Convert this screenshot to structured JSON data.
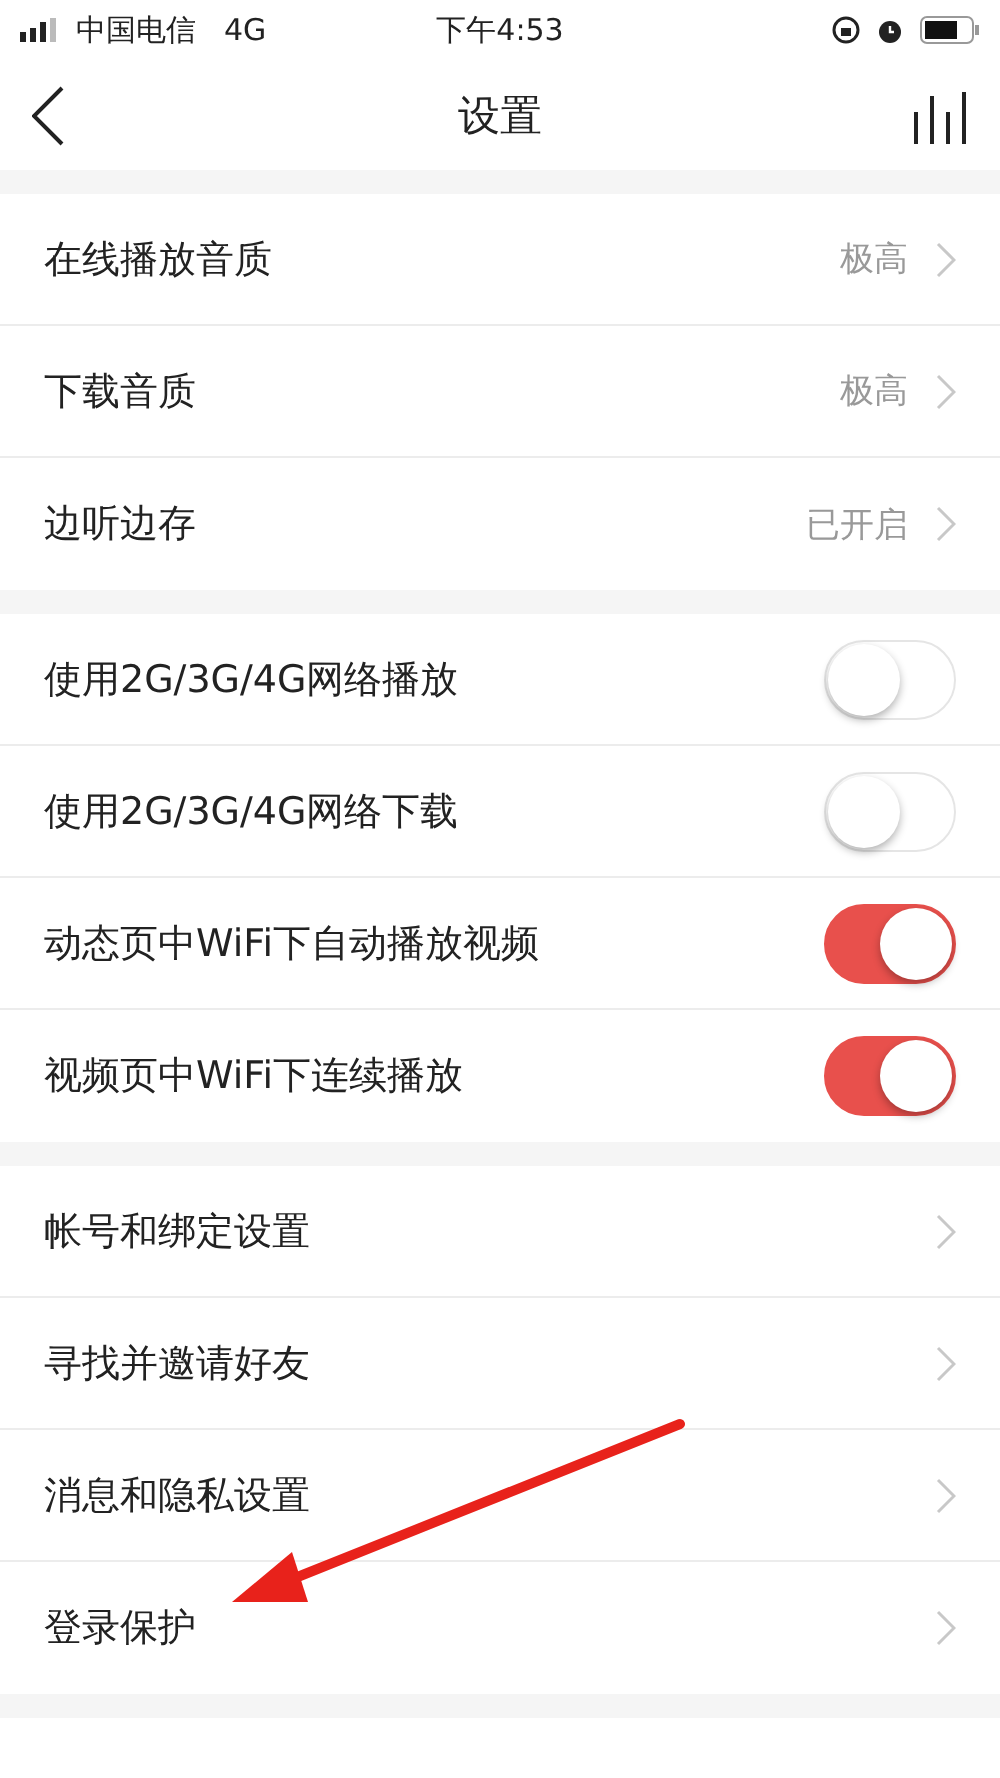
{
  "status_bar": {
    "carrier": "中国电信",
    "network": "4G",
    "time": "下午4:53"
  },
  "nav": {
    "title": "设置"
  },
  "groups": [
    {
      "items": [
        {
          "kind": "link",
          "label": "在线播放音质",
          "value": "极高"
        },
        {
          "kind": "link",
          "label": "下载音质",
          "value": "极高"
        },
        {
          "kind": "link",
          "label": "边听边存",
          "value": "已开启"
        }
      ]
    },
    {
      "items": [
        {
          "kind": "toggle",
          "label": "使用2G/3G/4G网络播放",
          "on": false
        },
        {
          "kind": "toggle",
          "label": "使用2G/3G/4G网络下载",
          "on": false
        },
        {
          "kind": "toggle",
          "label": "动态页中WiFi下自动播放视频",
          "on": true
        },
        {
          "kind": "toggle",
          "label": "视频页中WiFi下连续播放",
          "on": true
        }
      ]
    },
    {
      "items": [
        {
          "kind": "link",
          "label": "帐号和绑定设置"
        },
        {
          "kind": "link",
          "label": "寻找并邀请好友"
        },
        {
          "kind": "link",
          "label": "消息和隐私设置"
        },
        {
          "kind": "link",
          "label": "登录保护"
        }
      ]
    }
  ],
  "annotation": {
    "kind": "arrow"
  }
}
